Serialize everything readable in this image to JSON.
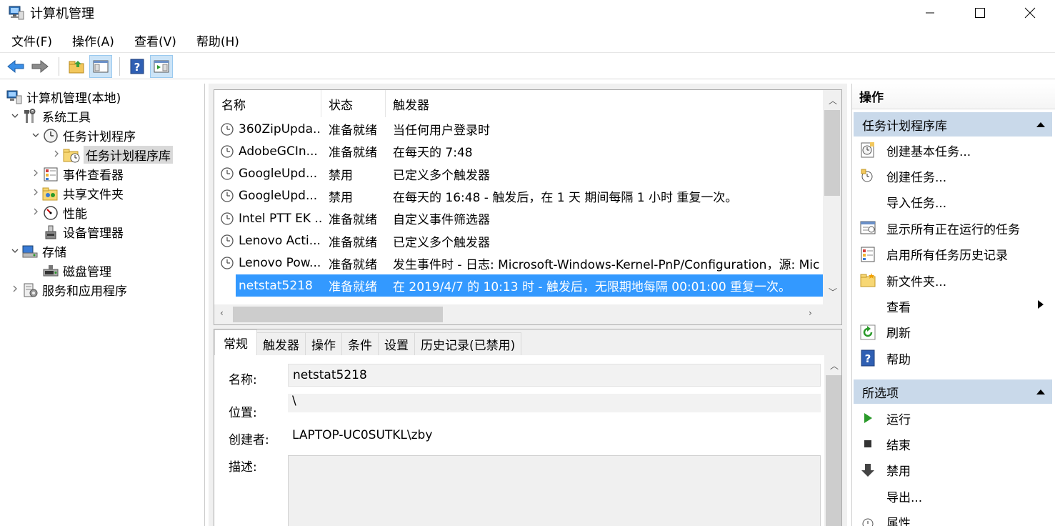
{
  "window": {
    "title": "计算机管理"
  },
  "menu": [
    "文件(F)",
    "操作(A)",
    "查看(V)",
    "帮助(H)"
  ],
  "tree": [
    {
      "label": "计算机管理(本地)",
      "indent": 0,
      "chev": "",
      "icon": "computer-management-icon",
      "selected": false
    },
    {
      "label": "系统工具",
      "indent": 1,
      "chev": "⌄",
      "icon": "tools-icon",
      "selected": false
    },
    {
      "label": "任务计划程序",
      "indent": 2,
      "chev": "⌄",
      "icon": "task-scheduler-icon",
      "selected": false
    },
    {
      "label": "任务计划程序库",
      "indent": 3,
      "chev": "›",
      "icon": "folder-clock-icon",
      "selected": true
    },
    {
      "label": "事件查看器",
      "indent": 2,
      "chev": "›",
      "icon": "event-viewer-icon",
      "selected": false
    },
    {
      "label": "共享文件夹",
      "indent": 2,
      "chev": "›",
      "icon": "shared-folder-icon",
      "selected": false
    },
    {
      "label": "性能",
      "indent": 2,
      "chev": "›",
      "icon": "performance-icon",
      "selected": false
    },
    {
      "label": "设备管理器",
      "indent": 2,
      "chev": "",
      "icon": "device-manager-icon",
      "selected": false
    },
    {
      "label": "存储",
      "indent": 1,
      "chev": "⌄",
      "icon": "storage-icon",
      "selected": false
    },
    {
      "label": "磁盘管理",
      "indent": 2,
      "chev": "",
      "icon": "disk-management-icon",
      "selected": false
    },
    {
      "label": "服务和应用程序",
      "indent": 1,
      "chev": "›",
      "icon": "services-icon",
      "selected": false
    }
  ],
  "task_list": {
    "columns": [
      "名称",
      "状态",
      "触发器"
    ],
    "rows": [
      {
        "name": "360ZipUpda...",
        "status": "准备就绪",
        "trigger": "当任何用户登录时",
        "selected": false
      },
      {
        "name": "AdobeGCIn...",
        "status": "准备就绪",
        "trigger": "在每天的 7:48",
        "selected": false
      },
      {
        "name": "GoogleUpd...",
        "status": "禁用",
        "trigger": "已定义多个触发器",
        "selected": false
      },
      {
        "name": "GoogleUpd...",
        "status": "禁用",
        "trigger": "在每天的 16:48 - 触发后，在 1 天 期间每隔 1 小时 重复一次。",
        "selected": false
      },
      {
        "name": "Intel PTT EK ...",
        "status": "准备就绪",
        "trigger": "自定义事件筛选器",
        "selected": false
      },
      {
        "name": "Lenovo Acti...",
        "status": "准备就绪",
        "trigger": "已定义多个触发器",
        "selected": false
      },
      {
        "name": "Lenovo Pow...",
        "status": "准备就绪",
        "trigger": "发生事件时 - 日志: Microsoft-Windows-Kernel-PnP/Configuration，源: Mic",
        "selected": false
      },
      {
        "name": "netstat5218",
        "status": "准备就绪",
        "trigger": "在 2019/4/7 的 10:13 时 - 触发后，无限期地每隔 00:01:00 重复一次。",
        "selected": true
      }
    ]
  },
  "tabs": [
    "常规",
    "触发器",
    "操作",
    "条件",
    "设置",
    "历史记录(已禁用)"
  ],
  "details": {
    "name_label": "名称:",
    "name_value": "netstat5218",
    "location_label": "位置:",
    "location_value": "\\",
    "author_label": "创建者:",
    "author_value": "LAPTOP-UC0SUTKL\\zby",
    "desc_label": "描述:"
  },
  "actions": {
    "title": "操作",
    "section1": "任务计划程序库",
    "items1": [
      {
        "label": "创建基本任务...",
        "icon": "create-basic-task-icon"
      },
      {
        "label": "创建任务...",
        "icon": "create-task-icon"
      },
      {
        "label": "导入任务...",
        "icon": ""
      },
      {
        "label": "显示所有正在运行的任务",
        "icon": "running-tasks-icon"
      },
      {
        "label": "启用所有任务历史记录",
        "icon": "task-history-icon"
      },
      {
        "label": "新文件夹...",
        "icon": "new-folder-icon"
      },
      {
        "label": "查看",
        "icon": "",
        "submenu": true
      },
      {
        "label": "刷新",
        "icon": "refresh-icon"
      },
      {
        "label": "帮助",
        "icon": "help-icon"
      }
    ],
    "section2": "所选项",
    "items2": [
      {
        "label": "运行",
        "icon": "run-icon"
      },
      {
        "label": "结束",
        "icon": "stop-icon"
      },
      {
        "label": "禁用",
        "icon": "disable-icon"
      },
      {
        "label": "导出...",
        "icon": ""
      },
      {
        "label": "属性",
        "icon": "properties-icon"
      }
    ]
  }
}
